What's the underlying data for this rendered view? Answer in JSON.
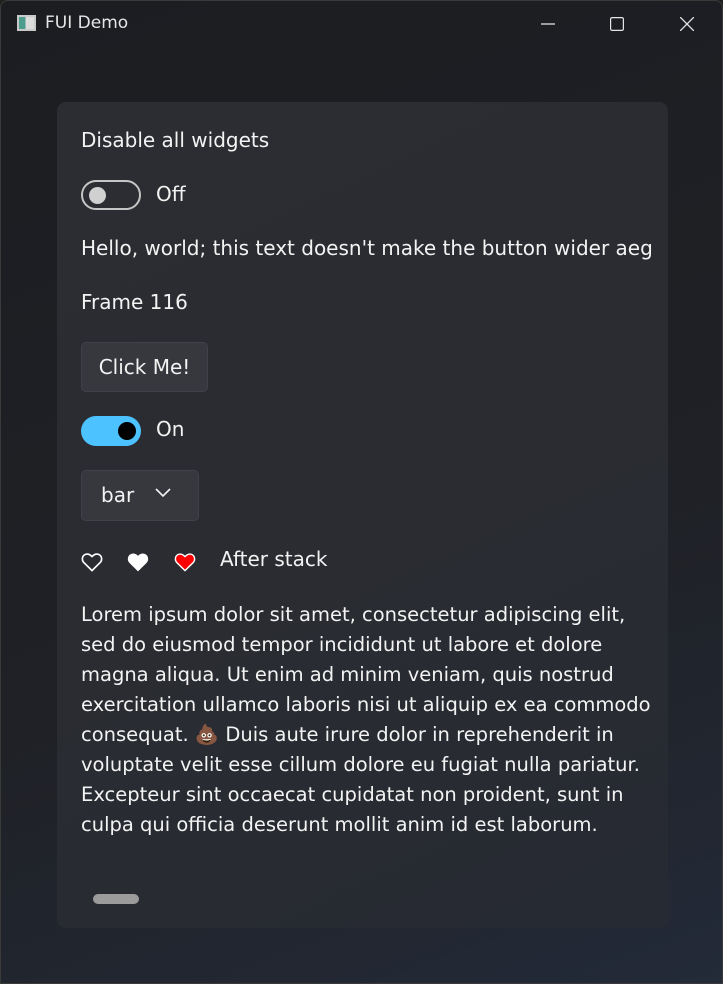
{
  "window": {
    "title": "FUI Demo"
  },
  "card": {
    "disable_all_label": "Disable all widgets",
    "disable_toggle": {
      "state_text": "Off",
      "checked": false
    },
    "hello_text": "Hello, world; this text doesn't make the button wider aeg",
    "frame_text": "Frame 116",
    "click_button_label": "Click Me!",
    "second_toggle": {
      "state_text": "On",
      "checked": true
    },
    "combo": {
      "selected": "bar"
    },
    "hearts": [
      {
        "icon": "heart-outline-icon",
        "color": "#ffffff"
      },
      {
        "icon": "heart-filled-icon",
        "color": "#ffffff"
      },
      {
        "icon": "heart-red-icon",
        "color": "#ff0000"
      }
    ],
    "after_stack_text": "After stack",
    "lorem_text": "Lorem ipsum dolor sit amet, consectetur adipiscing elit, sed do eiusmod tempor incididunt ut labore et dolore magna aliqua. Ut enim ad minim veniam, quis nostrud exercitation ullamco laboris nisi ut aliquip ex ea commodo consequat. 💩 Duis aute irure dolor in reprehenderit in voluptate velit esse cillum dolore eu fugiat nulla pariatur. Excepteur sint occaecat cupidatat non proident, sunt in culpa qui officia deserunt mollit anim id est laborum."
  },
  "colors": {
    "accent": "#4cc2ff",
    "heart_red": "#ff0000",
    "card_bg": "#2a2c31",
    "text": "#f3f3f3"
  }
}
